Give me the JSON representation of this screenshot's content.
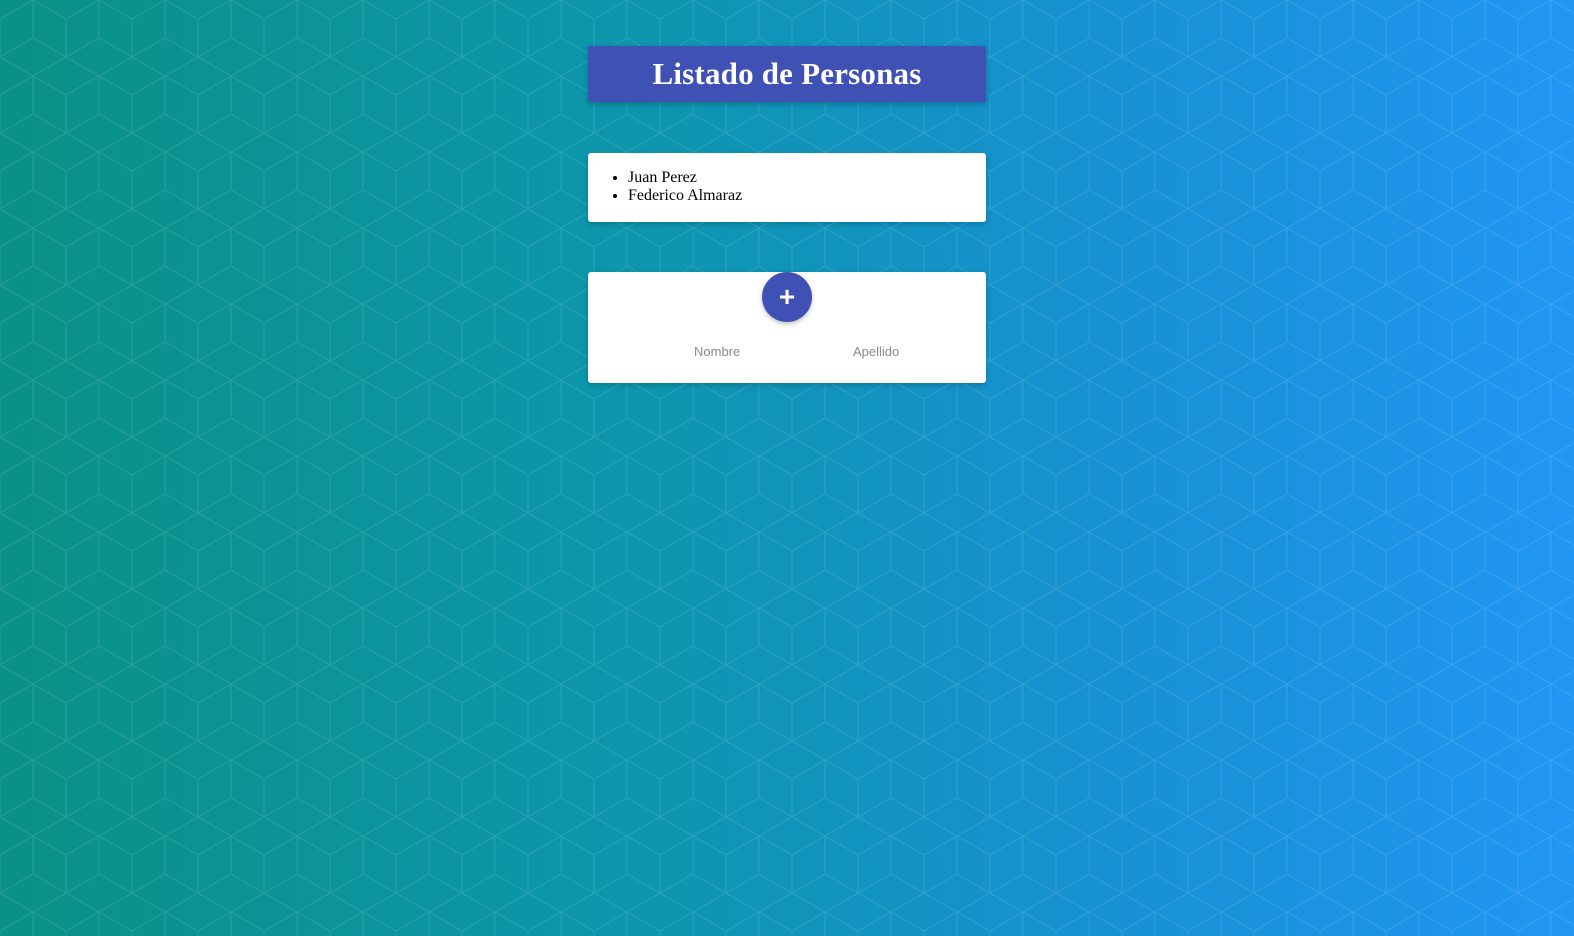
{
  "header": {
    "title": "Listado de Personas"
  },
  "people": [
    {
      "name": "Juan Perez"
    },
    {
      "name": "Federico Almaraz"
    }
  ],
  "form": {
    "add_button_label": "+",
    "nombre_label": "Nombre",
    "apellido_label": "Apellido",
    "nombre_value": "",
    "apellido_value": ""
  },
  "colors": {
    "primary": "#3f51b5",
    "background_start": "#0a9185",
    "background_end": "#2196f3",
    "card": "#ffffff",
    "label": "#8a8a8a"
  },
  "icons": {
    "add": "plus-icon"
  }
}
